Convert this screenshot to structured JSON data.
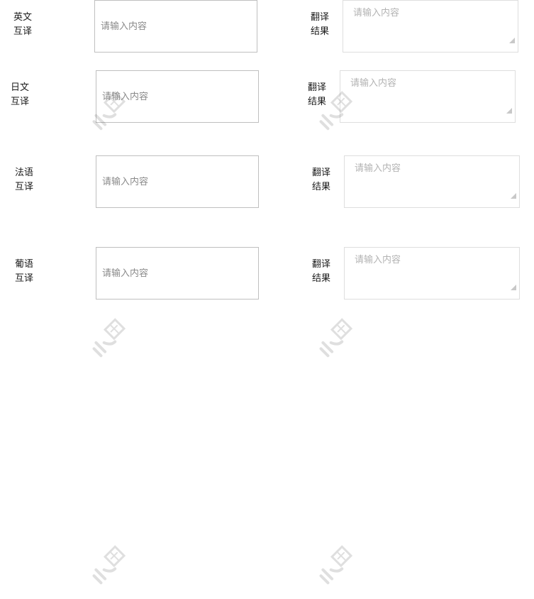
{
  "rows": [
    {
      "lang_label_line1": "英文",
      "lang_label_line2": "互译",
      "input_placeholder": "请输入内容",
      "result_label_line1": "翻译",
      "result_label_line2": "结果",
      "result_placeholder": "请输入内容"
    },
    {
      "lang_label_line1": "日文",
      "lang_label_line2": "互译",
      "input_placeholder": "请输入内容",
      "result_label_line1": "翻译",
      "result_label_line2": "结果",
      "result_placeholder": "请输入内容"
    },
    {
      "lang_label_line1": "法语",
      "lang_label_line2": "互译",
      "input_placeholder": "请输入内容",
      "result_label_line1": "翻译",
      "result_label_line2": "结果",
      "result_placeholder": "请输入内容"
    },
    {
      "lang_label_line1": "葡语",
      "lang_label_line2": "互译",
      "input_placeholder": "请输入内容",
      "result_label_line1": "翻译",
      "result_label_line2": "结果",
      "result_placeholder": "请输入内容"
    }
  ],
  "watermark_icon": "brand-watermark-icon"
}
